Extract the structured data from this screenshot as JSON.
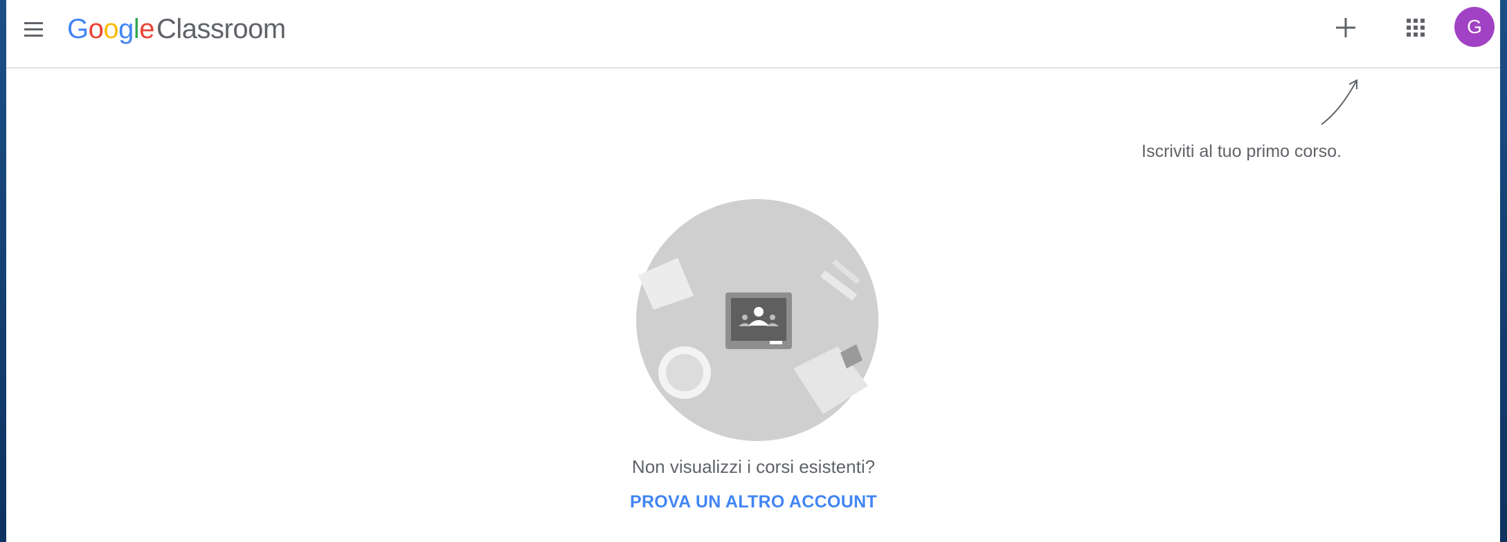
{
  "header": {
    "logo": {
      "google_letters": [
        {
          "char": "G",
          "color": "#4285F4"
        },
        {
          "char": "o",
          "color": "#EA4335"
        },
        {
          "char": "o",
          "color": "#FBBC05"
        },
        {
          "char": "g",
          "color": "#4285F4"
        },
        {
          "char": "l",
          "color": "#34A853"
        },
        {
          "char": "e",
          "color": "#EA4335"
        }
      ],
      "product": "Classroom"
    },
    "menu_icon": "hamburger-menu-icon",
    "add_icon": "plus-icon",
    "apps_icon": "apps-grid-icon",
    "avatar": {
      "initial": "G",
      "color": "#A142C4"
    }
  },
  "hint": {
    "text": "Iscriviti al tuo primo corso."
  },
  "empty_state": {
    "message": "Non visualizzi i corsi esistenti?",
    "action_label": "PROVA UN ALTRO ACCOUNT"
  },
  "colors": {
    "accent": "#4285F4",
    "text_secondary": "#5F6368",
    "divider": "#E0E0E0"
  }
}
